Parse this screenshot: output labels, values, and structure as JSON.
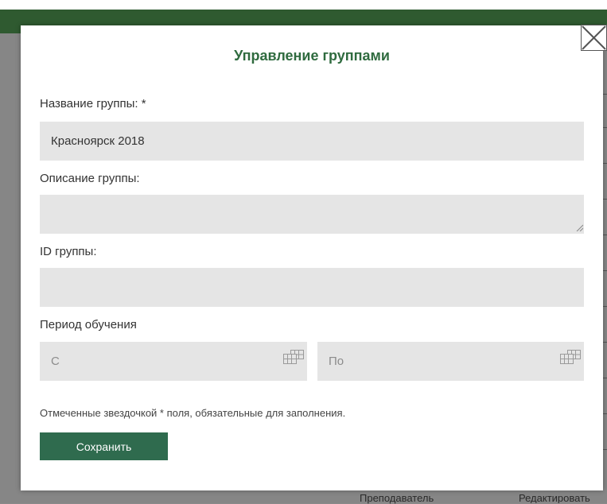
{
  "background": {
    "footer_col1": "Преподаватель",
    "footer_col2": "Редактировать"
  },
  "modal": {
    "title": "Управление группами",
    "close_icon": "close-x-icon",
    "name_label": "Название группы: *",
    "name_value": "Красноярск 2018",
    "description_label": "Описание группы:",
    "description_value": "",
    "id_label": "ID группы:",
    "id_value": "",
    "period_label": "Период обучения",
    "from_placeholder": "С",
    "to_placeholder": "По",
    "calendar_icon": "calendar-icon",
    "required_note": "Отмеченные звездочкой * поля, обязательные для заполнения.",
    "save_label": "Сохранить"
  },
  "colors": {
    "accent_green": "#2f6b4e",
    "title_green": "#2f6b3f",
    "field_bg": "#e5e5e5"
  }
}
